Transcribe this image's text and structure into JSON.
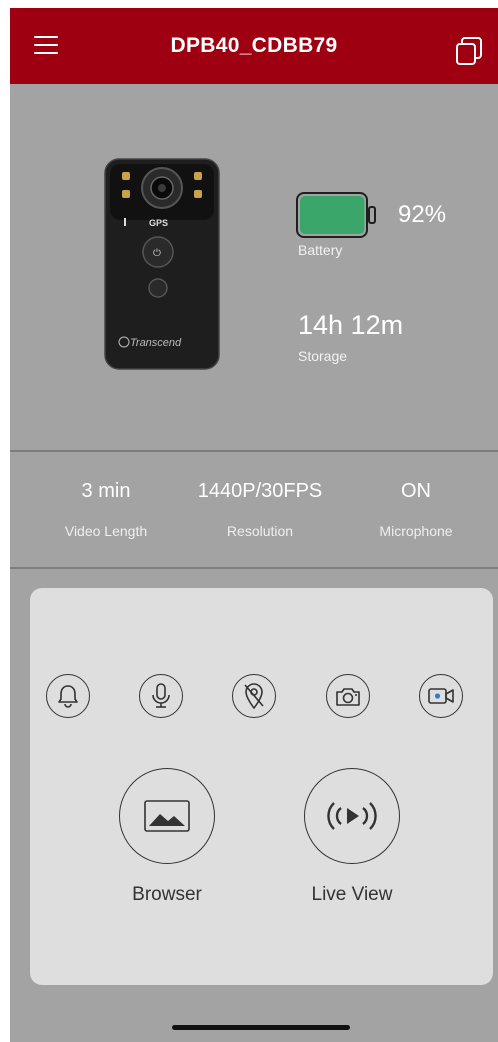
{
  "header": {
    "title": "DPB40_CDBB79",
    "menu_icon": "hamburger-menu-icon",
    "copy_icon": "copy-window-icon",
    "background_color": "#9e0012"
  },
  "device_status": {
    "battery_percent": "92%",
    "battery_level": 0.92,
    "battery_label": "Battery",
    "battery_color": "#3aa66a",
    "storage_value": "14h 12m",
    "storage_label": "Storage"
  },
  "device_image": {
    "brand_text": "Transcend",
    "gps_text": "GPS"
  },
  "settings": [
    {
      "value": "3 min",
      "label": "Video Length"
    },
    {
      "value": "1440P/30FPS",
      "label": "Resolution"
    },
    {
      "value": "ON",
      "label": "Microphone"
    }
  ],
  "quick_actions": [
    {
      "icon": "bell-icon"
    },
    {
      "icon": "microphone-icon"
    },
    {
      "icon": "location-off-icon"
    },
    {
      "icon": "camera-icon"
    },
    {
      "icon": "video-record-icon",
      "accent": "#2e7bd6"
    }
  ],
  "main_actions": {
    "browser_label": "Browser",
    "browser_icon": "image-gallery-icon",
    "live_view_label": "Live View",
    "live_view_icon": "live-stream-icon"
  }
}
